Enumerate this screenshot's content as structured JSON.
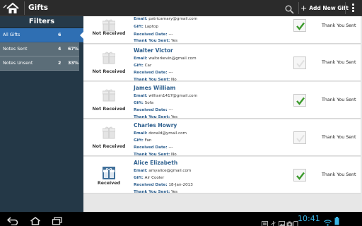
{
  "action_bar": {
    "title": "Gifts",
    "add_label": "Add New Gift",
    "icons": [
      "home-icon",
      "search-icon",
      "add-icon",
      "overflow-menu-icon"
    ]
  },
  "sidebar": {
    "title": "Filters",
    "items": [
      {
        "label": "All Gifts",
        "count": "6",
        "percent": "",
        "active": true
      },
      {
        "label": "Notes Sent",
        "count": "4",
        "percent": "67%",
        "active": false
      },
      {
        "label": "Notes Unsent",
        "count": "2",
        "percent": "33%",
        "active": false
      }
    ]
  },
  "labels": {
    "email": "Email:",
    "gift": "Gift:",
    "received_date": "Received Date:",
    "thank_you_sent": "Thank You Sent:"
  },
  "rows": [
    {
      "status": "Not Received",
      "name": "",
      "email": "patricamary@gmail.com",
      "gift": "Laptop",
      "received_date": "---",
      "thank_you_sent": "Yes",
      "checked": true,
      "right_label": "Thank You Sent"
    },
    {
      "status": "Not Received",
      "name": "Walter Victor",
      "email": "walterkevin@gmail.com",
      "gift": "Car",
      "received_date": "---",
      "thank_you_sent": "No",
      "checked": false,
      "right_label": "Thank You Sent"
    },
    {
      "status": "Not Received",
      "name": "James William",
      "email": "william1417@gmail.com",
      "gift": "Sofa",
      "received_date": "---",
      "thank_you_sent": "Yes",
      "checked": true,
      "right_label": "Thank You Sent"
    },
    {
      "status": "Not Received",
      "name": "Charles Howry",
      "email": "donald@ymail.com",
      "gift": "Fan",
      "received_date": "---",
      "thank_you_sent": "No",
      "checked": false,
      "right_label": "Thank You Sent"
    },
    {
      "status": "Received",
      "name": "Alice Elizabeth",
      "email": "amyalice@gmail.com",
      "gift": "Air Cooler",
      "received_date": "18-Jan-2013",
      "thank_you_sent": "Yes",
      "checked": true,
      "right_label": "Thank You Sent"
    }
  ],
  "system_bar": {
    "time": "10:41",
    "icons": [
      "back-icon",
      "home-nav-icon",
      "recent-apps-icon",
      "screenshot-icon",
      "usb-icon",
      "gallery-icon",
      "camera-icon",
      "sd-card-icon",
      "wifi-icon",
      "battery-icon"
    ]
  },
  "colors": {
    "accent": "#2f6fb3",
    "sidebar_bg": "#243847",
    "check_green": "#3a9a2a",
    "clock": "#39b5e6"
  }
}
